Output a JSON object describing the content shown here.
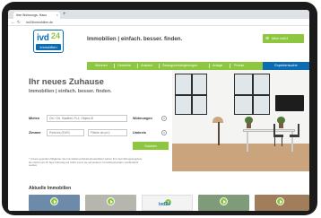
{
  "browser": {
    "tab_title": "Ihre Wohnungs- Haus",
    "tab_close": "×",
    "new_tab": "+",
    "back_glyph": "←",
    "reload_glyph": "↻",
    "url": "ivd24immobilien.de"
  },
  "header": {
    "logo_main": "ivd",
    "logo_num": "24",
    "logo_sub": "immobilien",
    "tagline": "Immobilien | einfach. besser. finden.",
    "member_button": "Mein ivd24",
    "member_icon": "plus-circle-icon"
  },
  "nav": {
    "items": [
      "Wohnen",
      "Gewerbe",
      "Ausland",
      "Zwangsversteigerungen",
      "Anlage",
      "Presse"
    ],
    "expert_button": "Expertensuche"
  },
  "hero": {
    "title": "Ihr neues Zuhause",
    "subtitle": "Immobilien | einfach. besser. finden."
  },
  "search": {
    "location_label": "Mieten",
    "location_placeholder": "Ort / Ort, Stadtteil, PLZ, Objekt-ID",
    "rooms_label": "Wohnungen",
    "price_label": "Zimmer",
    "price_placeholder": "Preis bis (EUR)",
    "area_placeholder": "Fläche ab (m²)",
    "extra_label": "Umkreis",
    "stepper_glyph": "±",
    "submit": "Suchen",
    "fineprint": "* Unsere geprüften Mitglieder des Immobilienverbands Deutschland stehen Ihre Vermittlungsangebote bis ehrlich seit 15 Tage frühzeitig auf ivd24, bevor sie auf anderen Immobilienportalen veröffentlicht werden."
  },
  "listings": {
    "title": "Aktuelle Immobilien",
    "thumb_logo": "ivd24",
    "colors": [
      "#6d8aa8",
      "#b7b6ae",
      "#f3f3f3",
      "#7f9b7a",
      "#a07e5c"
    ]
  },
  "colors": {
    "brand_blue": "#0b6db3",
    "brand_green": "#8dc63f"
  }
}
